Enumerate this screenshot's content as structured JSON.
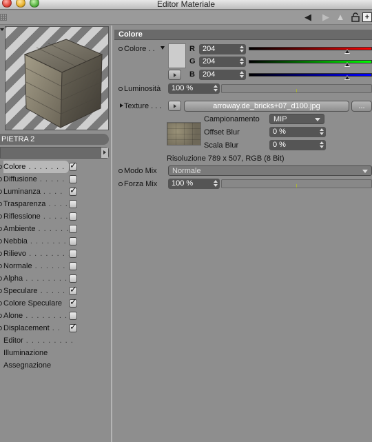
{
  "window": {
    "title": "Editor Materiale"
  },
  "toolbar": {
    "back_icon": "triangle-left-icon",
    "forward_icon": "triangle-up-icon",
    "lock_icon": "lock-icon",
    "add_icon": "plus-icon"
  },
  "material": {
    "name": "PIETRA 2",
    "name_field_value": ""
  },
  "channels": [
    {
      "label": "Colore",
      "dots": " . . . . . . .",
      "checked": "✓",
      "has_checkbox": true,
      "selected": true
    },
    {
      "label": "Diffusione",
      "dots": " . . . . .",
      "checked": "",
      "has_checkbox": true
    },
    {
      "label": "Luminanza",
      "dots": " . . . .",
      "checked": "✓",
      "has_checkbox": true
    },
    {
      "label": "Trasparenza",
      "dots": " . . . .",
      "checked": "",
      "has_checkbox": true
    },
    {
      "label": "Riflessione",
      "dots": " . . . . .",
      "checked": "",
      "has_checkbox": true
    },
    {
      "label": "Ambiente",
      "dots": " . . . . . .",
      "checked": "",
      "has_checkbox": true
    },
    {
      "label": "Nebbia",
      "dots": " . . . . . . . .",
      "checked": "",
      "has_checkbox": true
    },
    {
      "label": "Rilievo",
      "dots": " . . . . . . . .",
      "checked": "",
      "has_checkbox": true
    },
    {
      "label": "Normale",
      "dots": " . . . . . . .",
      "checked": "",
      "has_checkbox": true
    },
    {
      "label": "Alpha",
      "dots": " . . . . . . . . .",
      "checked": "",
      "has_checkbox": true
    },
    {
      "label": "Speculare",
      "dots": " . . . . . .",
      "checked": "✓",
      "has_checkbox": true
    },
    {
      "label": "Colore Speculare",
      "dots": "",
      "checked": "✓",
      "has_checkbox": true
    },
    {
      "label": "Alone",
      "dots": " . . . . . . . . .",
      "checked": "",
      "has_checkbox": true
    },
    {
      "label": "Displacement",
      "dots": " . .",
      "checked": "✓",
      "has_checkbox": true
    },
    {
      "label": "Editor",
      "dots": " . . . . . . . . .",
      "checked": "",
      "has_checkbox": false
    },
    {
      "label": "Illuminazione",
      "dots": "",
      "checked": "",
      "has_checkbox": false
    },
    {
      "label": "Assegnazione",
      "dots": "",
      "checked": "",
      "has_checkbox": false
    }
  ],
  "panel": {
    "section_title": "Colore",
    "colore_label": "Colore . .",
    "swatch_color": "#cccccc",
    "rgb": {
      "r_label": "R",
      "r_value": "204",
      "g_label": "G",
      "g_value": "204",
      "b_label": "B",
      "b_value": "204",
      "fraction": 0.8
    },
    "luminosita_label": "Luminosità",
    "luminosita_value": "100 %",
    "texture_label": "Texture . . .",
    "texture_file": "arroway.de_bricks+07_d100.jpg",
    "texture_more": "...",
    "campionamento_label": "Campionamento",
    "campionamento_value": "MIP",
    "offset_blur_label": "Offset Blur",
    "offset_blur_value": "0 %",
    "scala_blur_label": "Scala Blur",
    "scala_blur_value": "0 %",
    "risoluzione": "Risoluzione 789 x 507, RGB (8 Bit)",
    "modo_mix_label": "Modo Mix",
    "modo_mix_value": "Normale",
    "forza_mix_label": "Forza Mix",
    "forza_mix_value": "100 %"
  }
}
